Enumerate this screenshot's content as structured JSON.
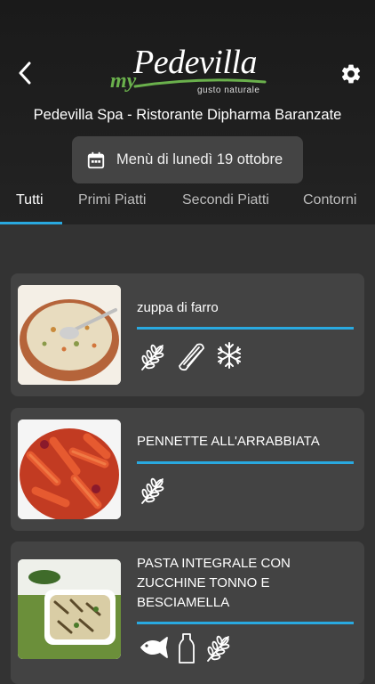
{
  "header": {
    "logo": {
      "prefix": "my",
      "brand": "Pedevilla",
      "tagline": "gusto naturale"
    },
    "venue": "Pedevilla Spa - Ristorante Dipharma Baranzate",
    "date_button": {
      "label": "Menù di lunedì 19 ottobre"
    }
  },
  "tabs": [
    {
      "label": "Tutti",
      "active": true
    },
    {
      "label": "Primi Piatti",
      "active": false
    },
    {
      "label": "Secondi Piatti",
      "active": false
    },
    {
      "label": "Contorni",
      "active": false
    }
  ],
  "dishes": [
    {
      "name": "zuppa di farro",
      "allergens": [
        "wheat-icon",
        "celery-icon",
        "snowflake-icon"
      ]
    },
    {
      "name": "PENNETTE ALL'ARRABBIATA",
      "allergens": [
        "wheat-icon"
      ]
    },
    {
      "name": "PASTA INTEGRALE CON ZUCCHINE TONNO E BESCIAMELLA",
      "allergens": [
        "fish-icon",
        "milk-bottle-icon",
        "wheat-icon"
      ]
    }
  ],
  "colors": {
    "accent": "#29a9e0",
    "brand_green": "#6ab04c",
    "background": "#333333",
    "card": "#434343"
  }
}
